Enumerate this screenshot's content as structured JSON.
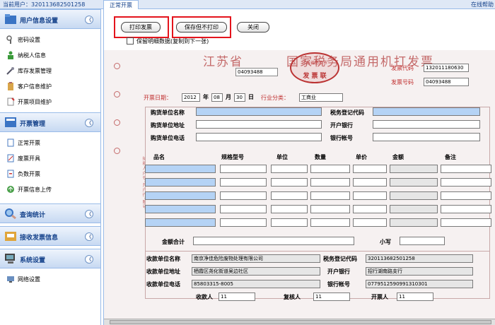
{
  "topbar": {
    "user_label": "当前用户：320113682501258",
    "help": "在线帮助",
    "tab": "正常开票"
  },
  "sidebar": {
    "sections": [
      {
        "label": "用户信息设置",
        "toggle": "《",
        "items": [
          "密码设置",
          "纳税人信息",
          "库存发票管理",
          "客户信息维护",
          "开票项目维护"
        ]
      },
      {
        "label": "开票管理",
        "toggle": "《",
        "items": [
          "正常开票",
          "废票开具",
          "负数开票",
          "开票信息上传"
        ]
      },
      {
        "label": "查询统计",
        "toggle": "《",
        "items": []
      },
      {
        "label": "接收发票信息",
        "toggle": "《",
        "items": []
      },
      {
        "label": "系统设置",
        "toggle": "《",
        "items": [
          "网络设置"
        ]
      }
    ]
  },
  "toolbar": {
    "print": "打印发票",
    "save_no_print": "保存但不打印",
    "close": "关闭",
    "keep_data": "保留明细数据(复制到下一张)"
  },
  "invoice": {
    "title_left": "江苏省",
    "title_right": "国家税务局通用机打发票",
    "stamp_top": "江苏省南京市",
    "stamp_main": "发 票 联",
    "invoice_code_label": "发票代码",
    "invoice_code": "132011180630",
    "invoice_no_label": "发票号码",
    "invoice_no": "04093488",
    "invoice_no_top": "04093488",
    "date_label": "开票日期：",
    "year": "2012",
    "year_unit": "年",
    "month": "08",
    "month_unit": "月",
    "day": "30",
    "day_unit": "日",
    "industry_label": "行业分类：",
    "industry": "工商业",
    "buyer_name_label": "购货单位名称",
    "buyer_addr_label": "购货单位地址",
    "buyer_phone_label": "购货单位电话",
    "tax_code_label": "税务登记代码",
    "bank_label": "开户银行",
    "account_label": "银行帐号",
    "col_name": "品名",
    "col_spec": "规格型号",
    "col_unit": "单位",
    "col_qty": "数量",
    "col_price": "单价",
    "col_amount": "金额",
    "col_note": "备注",
    "total_label": "金额合计",
    "upper_label": "小写",
    "seller_name_label": "收款单位名称",
    "seller_name": "南京净佳危险废物处理有限公司",
    "seller_tax_label": "税务登记代码",
    "seller_tax": "320113682501258",
    "seller_addr_label": "收款单位地址",
    "seller_addr": "栖霞区尧化街道吴边社区",
    "seller_bank_label": "开户银行",
    "seller_bank": "招行湖南路支行",
    "seller_phone_label": "收款单位电话",
    "seller_phone": "85803315-8005",
    "seller_account_label": "银行帐号",
    "seller_account": "0779512590991310301",
    "payee_label": "收款人",
    "payee": "11",
    "reviewer_label": "复核人",
    "reviewer": "11",
    "issuer_label": "开票人",
    "issuer": "11",
    "side_text": "纳税人户号·开户行·账号"
  },
  "colors": {
    "red_highlight": "#e4141c",
    "field_blue": "#b5d3f5",
    "header_blue": "#15428b"
  }
}
